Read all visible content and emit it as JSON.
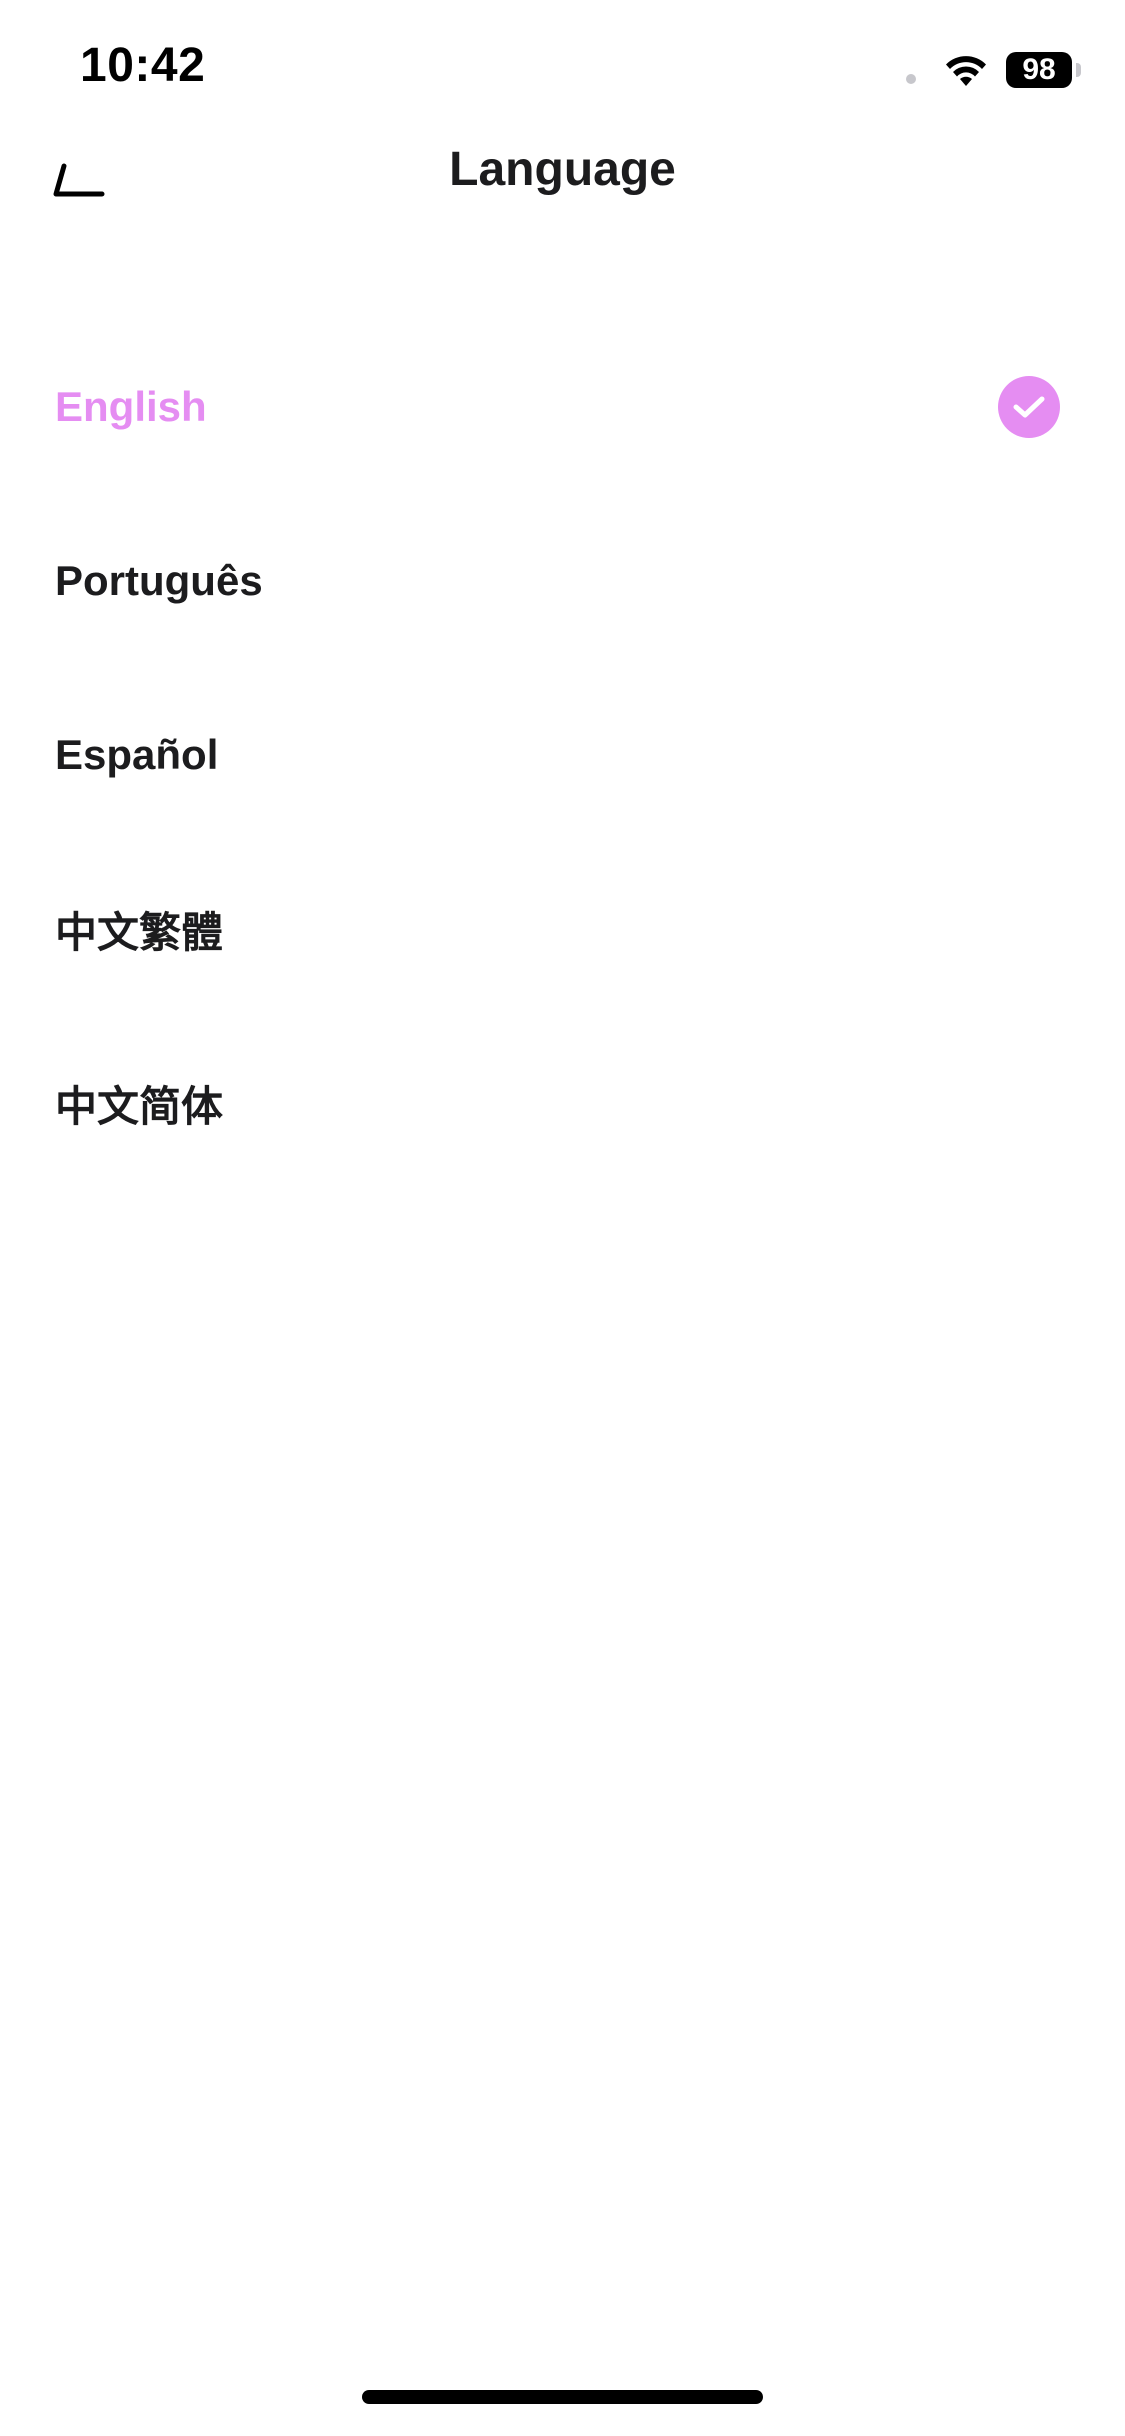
{
  "status_bar": {
    "time": "10:42",
    "battery": "98",
    "icons": [
      "signal-dot-icon",
      "wifi-icon",
      "battery-icon"
    ]
  },
  "nav": {
    "title": "Language",
    "back_icon": "back-arrow-icon"
  },
  "languages": [
    {
      "label": "English",
      "selected": true
    },
    {
      "label": "Português",
      "selected": false
    },
    {
      "label": "Español",
      "selected": false
    },
    {
      "label": "中文繁體",
      "selected": false
    },
    {
      "label": "中文简体",
      "selected": false
    }
  ],
  "colors": {
    "accent": "#e58df2",
    "text": "#1c1c1e",
    "background": "#ffffff"
  }
}
